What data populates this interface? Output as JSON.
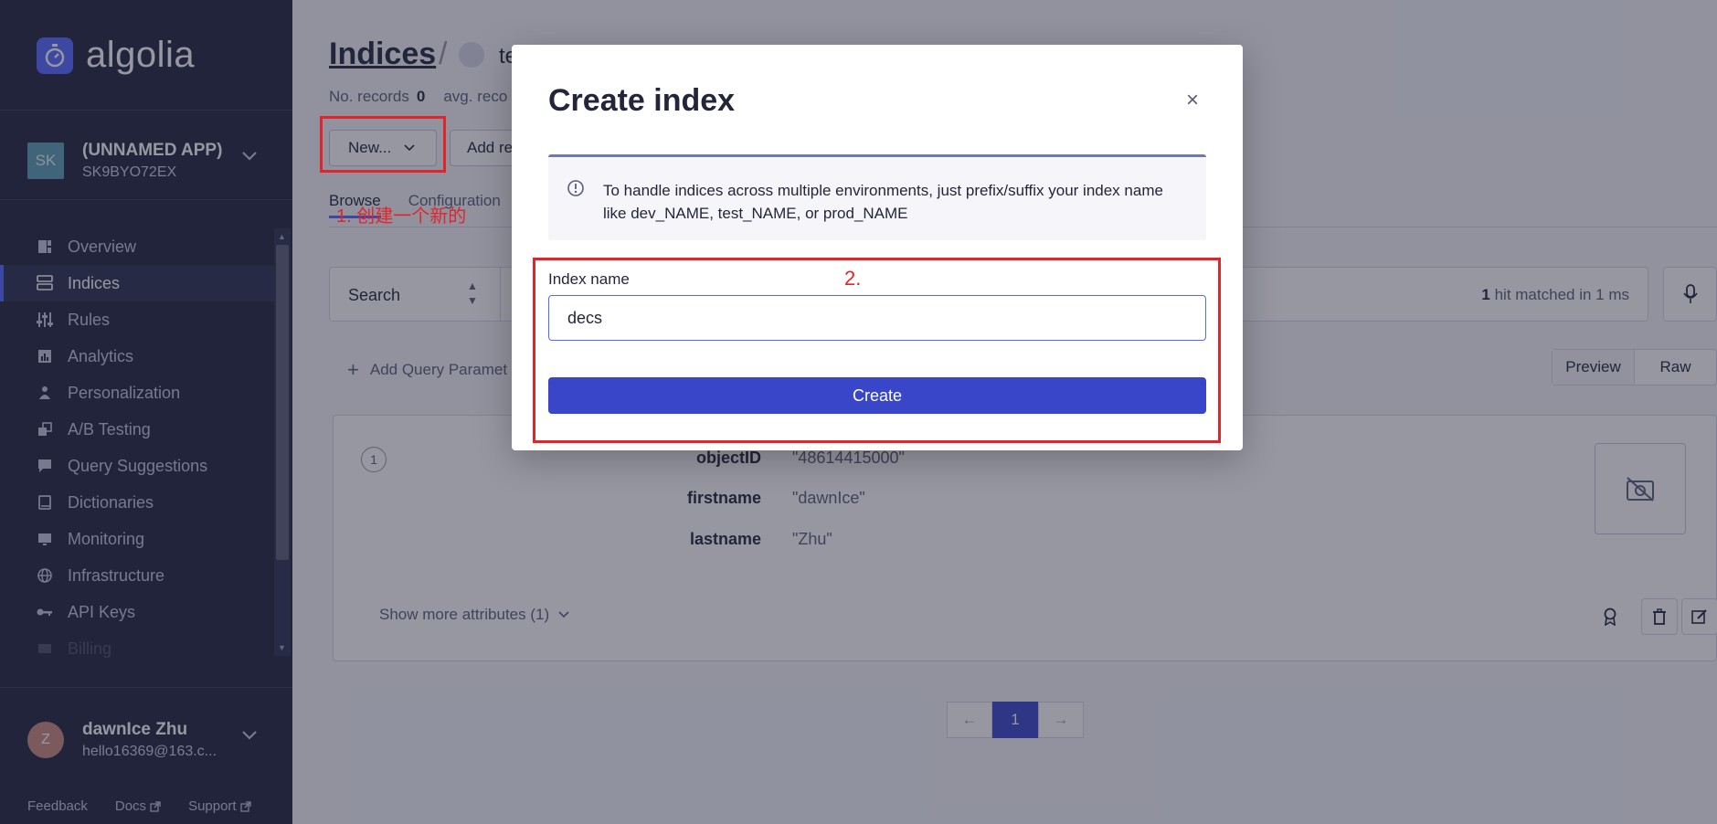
{
  "brand": {
    "name": "algolia"
  },
  "app": {
    "avatar": "SK",
    "name": "(UNNAMED APP)",
    "id": "SK9BYO72EX"
  },
  "nav": {
    "items": [
      {
        "label": "Overview",
        "icon": "overview-icon"
      },
      {
        "label": "Indices",
        "icon": "indices-icon",
        "active": true
      },
      {
        "label": "Rules",
        "icon": "rules-icon"
      },
      {
        "label": "Analytics",
        "icon": "analytics-icon"
      },
      {
        "label": "Personalization",
        "icon": "personalization-icon"
      },
      {
        "label": "A/B Testing",
        "icon": "ab-testing-icon"
      },
      {
        "label": "Query Suggestions",
        "icon": "query-suggestions-icon"
      },
      {
        "label": "Dictionaries",
        "icon": "dictionaries-icon"
      },
      {
        "label": "Monitoring",
        "icon": "monitoring-icon"
      },
      {
        "label": "Infrastructure",
        "icon": "infrastructure-icon"
      },
      {
        "label": "API Keys",
        "icon": "api-keys-icon"
      },
      {
        "label": "Billing",
        "icon": "billing-icon"
      }
    ]
  },
  "user": {
    "avatar": "Z",
    "name": "dawnIce Zhu",
    "email": "hello16369@163.c..."
  },
  "footer": {
    "feedback": "Feedback",
    "docs": "Docs",
    "support": "Support"
  },
  "page": {
    "title": "Indices",
    "slash": "/",
    "index_name": "te",
    "stats_records_label": "No. records",
    "stats_records_value": "0",
    "stats_avg_label": "avg. reco",
    "new_button": "New...",
    "add_button": "Add re",
    "tabs": {
      "browse": "Browse",
      "configuration": "Configuration"
    }
  },
  "search": {
    "type": "Search",
    "hits_count": "1",
    "hits_text": " hit matched in 1 ms"
  },
  "results": {
    "add_query_params": "Add Query Paramet",
    "add_plus": "+",
    "view_preview": "Preview",
    "view_raw": "Raw",
    "hit_number": "1",
    "attributes": [
      {
        "key": "objectID",
        "value": "\"48614415000\""
      },
      {
        "key": "firstname",
        "value": "\"dawnIce\""
      },
      {
        "key": "lastname",
        "value": "\"Zhu\""
      }
    ],
    "show_more": "Show more attributes (1)"
  },
  "pagination": {
    "prev": "←",
    "current": "1",
    "next": "→"
  },
  "annotations": {
    "step1": "1. 创建一个新的",
    "step2": "2."
  },
  "modal": {
    "title": "Create index",
    "close": "×",
    "info": "To handle indices across multiple environments, just prefix/suffix your index name like dev_NAME, test_NAME, or prod_NAME",
    "field_label": "Index name",
    "field_value": "decs",
    "submit": "Create"
  },
  "colors": {
    "sidebar_bg": "#21243d",
    "accent": "#5468ff",
    "primary_button": "#3a46c9",
    "annotation_red": "#e0252d"
  }
}
